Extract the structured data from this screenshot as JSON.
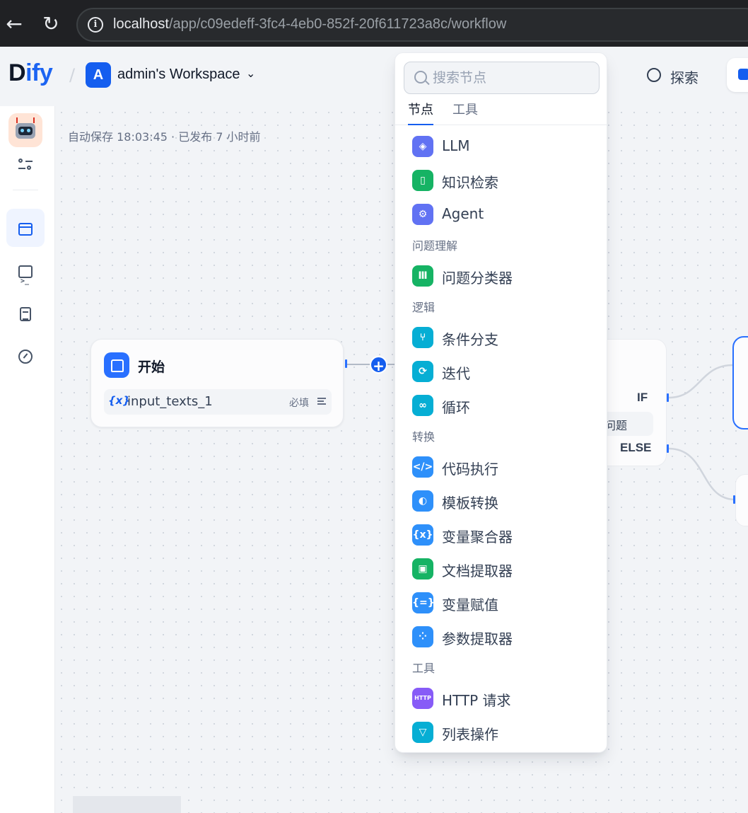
{
  "browser": {
    "back_glyph": "←",
    "reload_glyph": "↻",
    "info_glyph": "i",
    "url_host": "localhost",
    "url_path": "/app/c09edeff-3fc4-4eb0-852f-20f611723a8c/workflow"
  },
  "header": {
    "logo_prefix": "D",
    "logo_accent": "ify",
    "separator": "/",
    "workspace_initial": "A",
    "workspace_name": "admin's Workspace",
    "chevron": "⌄",
    "explore_label": "探索"
  },
  "canvas": {
    "autosave_status": "自动保存 18:03:45 · 已发布 7 小时前",
    "start_node": {
      "title": "开始",
      "variable_badge": "{x}",
      "variable_name": "input_texts_1",
      "required_label": "必填"
    },
    "add_glyph": "+",
    "if_node": {
      "if_label": "IF",
      "else_label": "ELSE",
      "condition_fragment": "问题"
    }
  },
  "picker": {
    "search_placeholder": "搜索节点",
    "tabs": [
      {
        "label": "节点",
        "active": true
      },
      {
        "label": "工具",
        "active": false
      }
    ],
    "items": [
      {
        "label": "LLM",
        "icon": "llm-icon",
        "color": "#6172f3"
      },
      {
        "label": "知识检索",
        "icon": "knowledge-retrieval-icon",
        "color": "#16b364"
      },
      {
        "label": "Agent",
        "icon": "agent-icon",
        "color": "#6172f3"
      },
      {
        "label": "问题分类器",
        "icon": "question-classifier-icon",
        "color": "#16b364"
      },
      {
        "label": "条件分支",
        "icon": "if-else-icon",
        "color": "#06aed4"
      },
      {
        "label": "迭代",
        "icon": "iteration-icon",
        "color": "#06aed4"
      },
      {
        "label": "循环",
        "icon": "loop-icon",
        "color": "#06aed4"
      },
      {
        "label": "代码执行",
        "icon": "code-icon",
        "color": "#2e90fa"
      },
      {
        "label": "模板转换",
        "icon": "template-transform-icon",
        "color": "#2e90fa"
      },
      {
        "label": "变量聚合器",
        "icon": "variable-aggregator-icon",
        "color": "#2e90fa"
      },
      {
        "label": "文档提取器",
        "icon": "document-extractor-icon",
        "color": "#16b364"
      },
      {
        "label": "变量赋值",
        "icon": "variable-assigner-icon",
        "color": "#2e90fa"
      },
      {
        "label": "参数提取器",
        "icon": "parameter-extractor-icon",
        "color": "#2e90fa"
      },
      {
        "label": "HTTP 请求",
        "icon": "http-request-icon",
        "color": "#875bf7",
        "icon_text": "HTTP"
      },
      {
        "label": "列表操作",
        "icon": "list-operator-icon",
        "color": "#06aed4"
      }
    ],
    "groups": {
      "question_understanding": "问题理解",
      "logic": "逻辑",
      "transform": "转换",
      "tools": "工具"
    }
  }
}
